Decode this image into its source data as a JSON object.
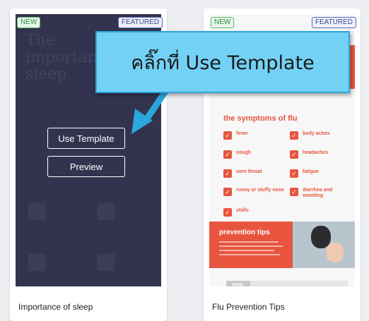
{
  "callout": {
    "text": "คลิ๊กที่ Use Template"
  },
  "cards": [
    {
      "title": "Importance of sleep",
      "badge_new": "NEW",
      "badge_featured": "FEATURED",
      "use_template_label": "Use Template",
      "preview_label": "Preview"
    },
    {
      "title": "Flu Prevention Tips",
      "badge_new": "NEW",
      "badge_featured": "FEATURED",
      "thumbnail": {
        "symptoms_heading": "the symptoms of flu",
        "symptoms": [
          "fever",
          "body aches",
          "cough",
          "headaches",
          "sore throat",
          "fatigue",
          "runny or stuffy nose",
          "diarrhea and vomiting",
          "chills"
        ],
        "prevention_heading": "prevention tips",
        "progress_percent": 20,
        "progress_label": "20%"
      }
    }
  ],
  "colors": {
    "accent_red": "#e8553f",
    "callout_bg": "#73d1f5",
    "arrow": "#2aa7dc",
    "left_thumb_bg": "#34334f"
  }
}
